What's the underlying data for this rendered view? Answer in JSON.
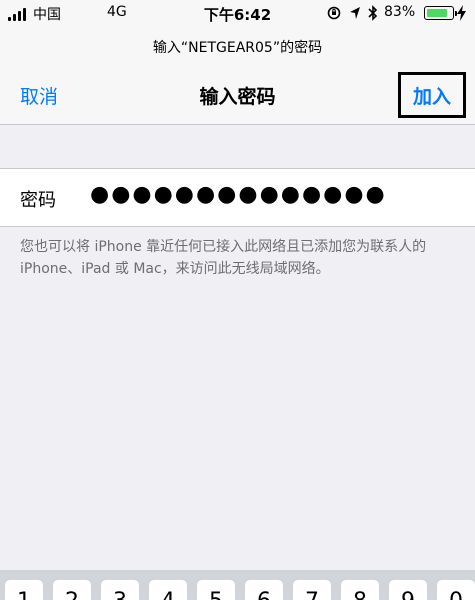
{
  "status_bar": {
    "carrier": "中国",
    "network": "4G",
    "time": "下午6:42",
    "battery_percent": "83%",
    "battery_level": 0.83,
    "battery_color": "#4cd964"
  },
  "prompt": "输入“NETGEAR05”的密码",
  "nav": {
    "cancel_label": "取消",
    "title": "输入密码",
    "join_label": "加入",
    "accent_color": "#007aff"
  },
  "password_field": {
    "label": "密码",
    "value": "●●●●●●●●●●●●●●"
  },
  "hint_text": "您也可以将 iPhone 靠近任何已接入此网络且已添加您为联系人的 iPhone、iPad 或 Mac，来访问此无线局域网络。",
  "keyboard": {
    "visible_keys": [
      "1",
      "2",
      "3",
      "4",
      "5",
      "6",
      "7",
      "8",
      "9",
      "0"
    ]
  }
}
